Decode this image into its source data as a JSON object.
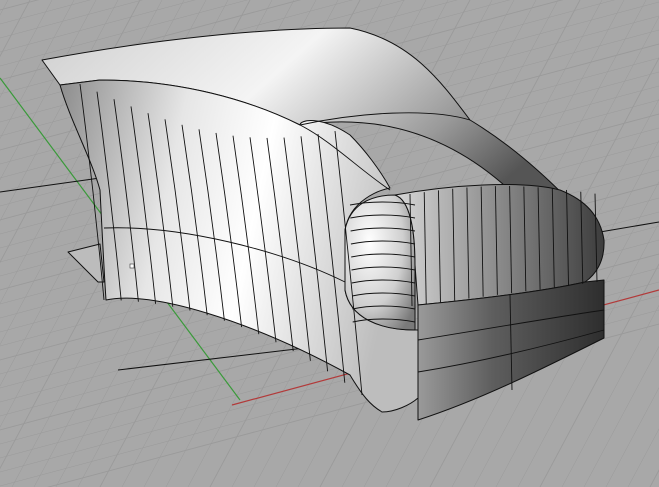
{
  "viewport": {
    "kind": "perspective-3d-view",
    "background_color": "#a8a8a8",
    "grid_line_color": "#9a9a9a",
    "grid_major_color": "#939393",
    "x_axis_color": "#b23a3a",
    "y_axis_color": "#3a9a3a",
    "model_edge_color": "#111111",
    "model_light_color": "#f2f2f2",
    "model_dark_color": "#3a3a3a"
  },
  "model": {
    "name_icon": "nurbs-surface-model",
    "description_visible": false
  }
}
